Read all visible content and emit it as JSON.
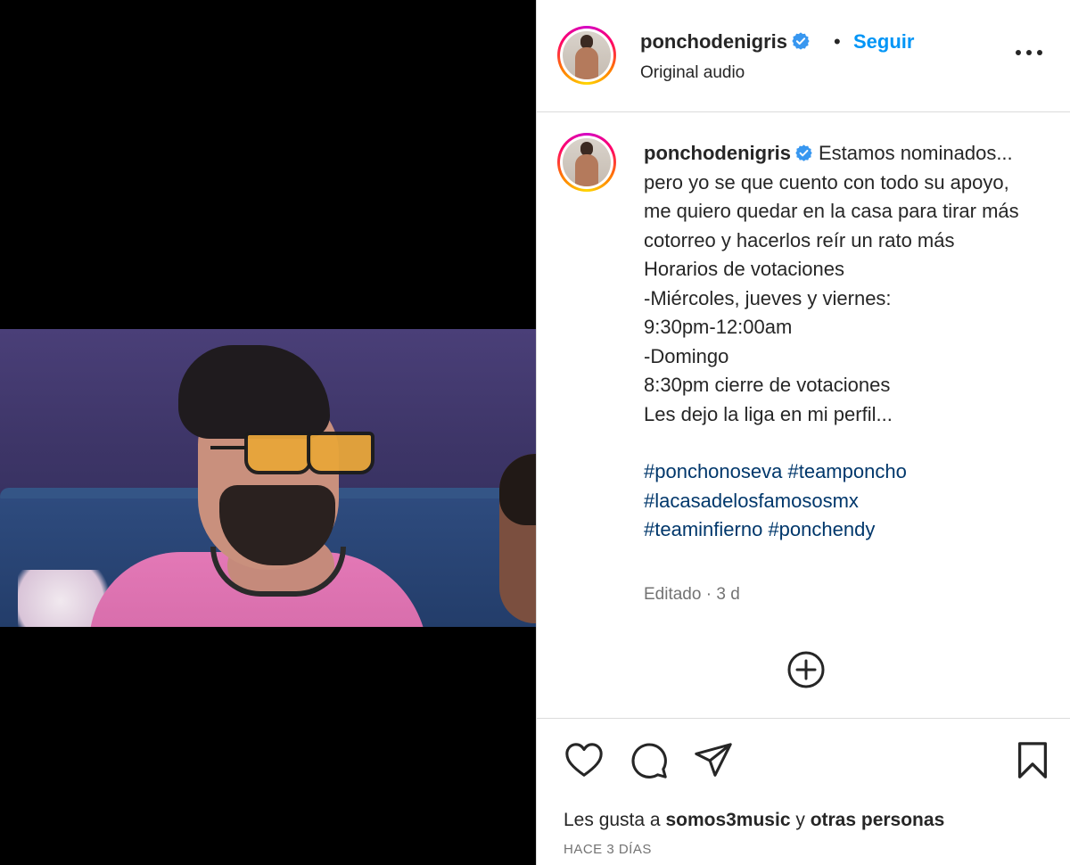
{
  "post": {
    "username": "ponchodenigris",
    "follow_label": "Seguir",
    "separator": "•",
    "audio_label": "Original audio",
    "more_icon": "more-horizontal-icon"
  },
  "caption": {
    "username": "ponchodenigris",
    "lines": [
      "Estamos nominados... pero yo se que cuento con todo su apoyo, me quiero quedar en la casa para tirar más cotorreo y hacerlos reír un rato más",
      "Horarios de votaciones",
      "-Miércoles, jueves y viernes:",
      "9:30pm-12:00am",
      "-Domingo",
      "8:30pm cierre de votaciones",
      "Les dejo la liga en mi perfil..."
    ],
    "hashtags": [
      "#ponchonoseva",
      "#teamponcho",
      "#lacasadelosfamososmx",
      "#teaminfierno",
      "#ponchendy"
    ],
    "edited": "Editado",
    "meta_sep": "·",
    "age": "3 d"
  },
  "actions": {
    "like_icon": "heart-icon",
    "comment_icon": "comment-icon",
    "share_icon": "send-icon",
    "save_icon": "bookmark-icon"
  },
  "likes": {
    "prefix": "Les gusta a",
    "user": "somos3music",
    "connector": "y",
    "others": "otras personas"
  },
  "timestamp": "HACE 3 DÍAS",
  "colors": {
    "link_blue": "#0095f6",
    "hashtag": "#00376b",
    "verified": "#3897f0",
    "secondary_text": "#737373"
  }
}
